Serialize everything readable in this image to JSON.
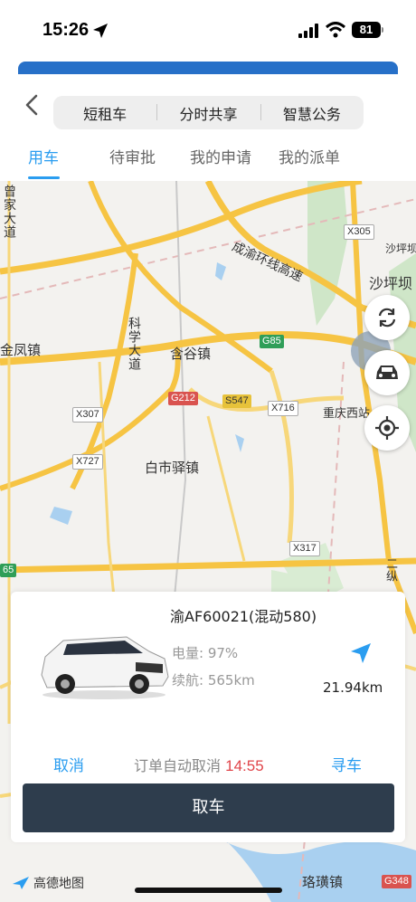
{
  "status_bar": {
    "time": "15:26",
    "battery": "81"
  },
  "header": {
    "segments": [
      "短租车",
      "分时共享",
      "智慧公务"
    ],
    "tabs": [
      "用车",
      "待审批",
      "我的申请",
      "我的派单"
    ],
    "active_tab": "用车"
  },
  "map": {
    "labels": {
      "zengjia": "曾家大道",
      "chengyu": "成渝环线高速",
      "shapingba_sign": "沙坪坝",
      "shapingba": "沙坪坝",
      "jinfeng": "金凤镇",
      "kexue": "科学大道",
      "hangu": "含谷镇",
      "chongqing_west": "重庆西站",
      "baishiyi": "白市驿镇",
      "lin": "二纵",
      "huanglou": "珞璜镇"
    },
    "road_badges": {
      "x305": "X305",
      "g85": "G85",
      "g212": "G212",
      "s547": "S547",
      "x716": "X716",
      "x307": "X307",
      "x727": "X727",
      "x317": "X317",
      "g348": "G348",
      "g65": "65"
    },
    "controls": [
      "refresh-icon",
      "car-icon",
      "locate-icon"
    ],
    "provider": "高德地图"
  },
  "vehicle_card": {
    "plate": "渝AF60021(混动580)",
    "battery": "电量: 97%",
    "range": "续航: 565km",
    "distance": "21.94km",
    "cancel": "取消",
    "auto_cancel_text": "订单自动取消",
    "countdown": "14:55",
    "find_car": "寻车",
    "pickup": "取车"
  },
  "colors": {
    "accent": "#2a9df0",
    "button_dark": "#2e3d4d",
    "countdown": "#e0454a",
    "header_bar": "#2770c8"
  }
}
